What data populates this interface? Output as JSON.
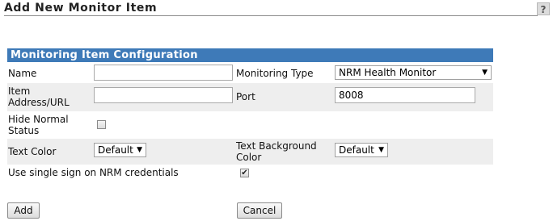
{
  "header": {
    "title": "Add New Monitor Item",
    "help_label": "?"
  },
  "section": {
    "title": "Monitoring Item Configuration"
  },
  "fields": {
    "name": {
      "label": "Name",
      "value": ""
    },
    "monitoring_type": {
      "label": "Monitoring Type",
      "value": "NRM Health Monitor"
    },
    "item_address": {
      "label": "Item Address/URL",
      "value": ""
    },
    "port": {
      "label": "Port",
      "value": "8008"
    },
    "hide_normal_status": {
      "label": "Hide Normal Status",
      "checked": false
    },
    "text_color": {
      "label": "Text Color",
      "value": "Default"
    },
    "text_background_color": {
      "label": "Text Background Color",
      "value": "Default"
    },
    "single_sign_on": {
      "label": "Use single sign on NRM credentials",
      "checked": true
    }
  },
  "buttons": {
    "add": "Add",
    "cancel": "Cancel"
  },
  "icons": {
    "dropdown": "chevron-down-icon",
    "check": "check-icon"
  }
}
